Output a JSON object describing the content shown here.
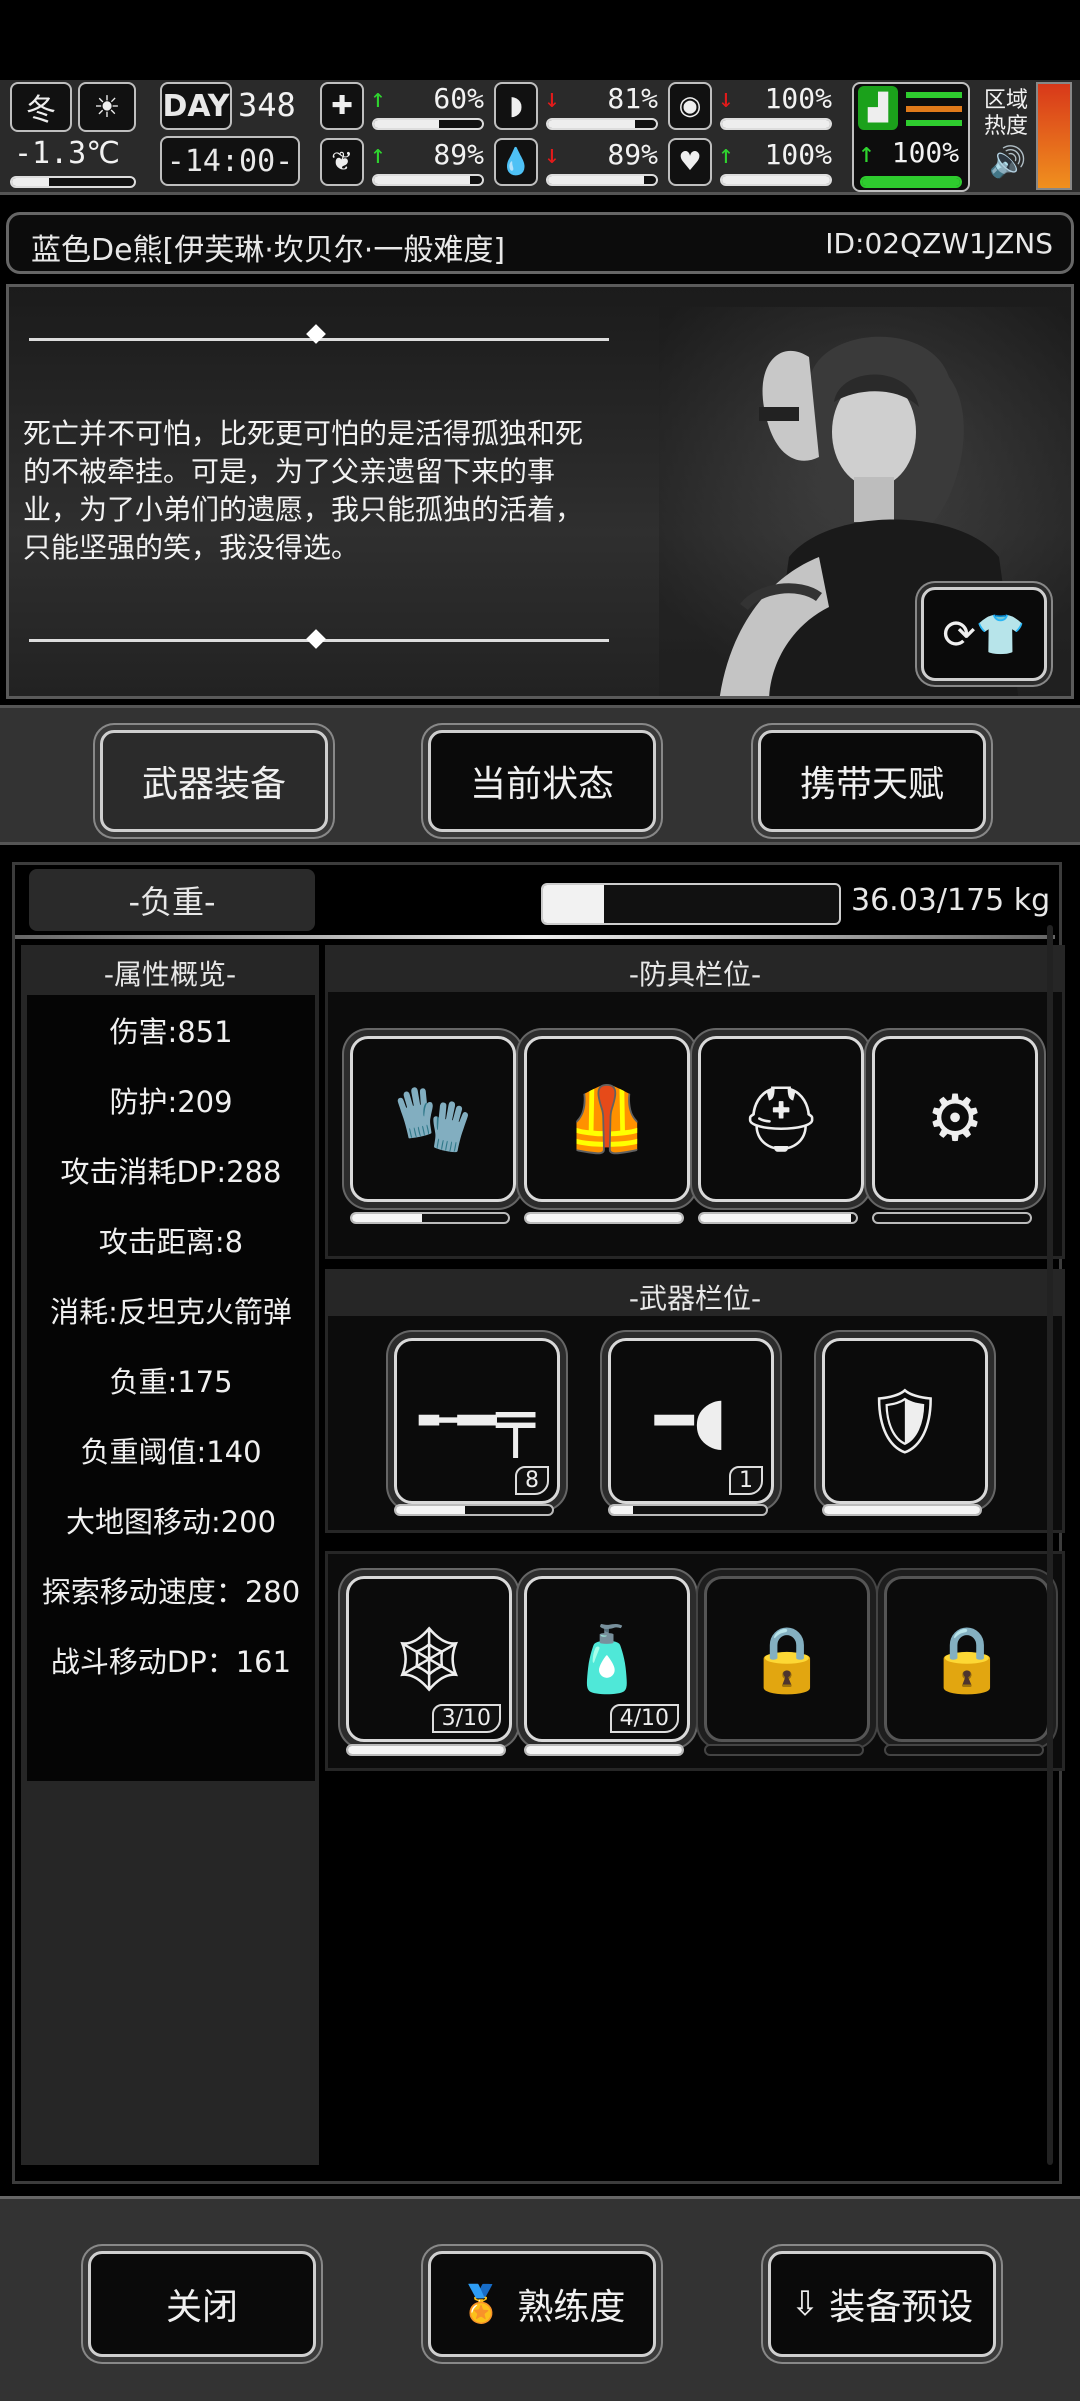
{
  "hud": {
    "season": "冬",
    "weather_icon": "sun-icon",
    "temperature": "-1.3℃",
    "day_label": "DAY",
    "day_value": "348",
    "time": "-14:00-",
    "stats": [
      {
        "name": "health",
        "icon": "medkit-icon",
        "trend": "up",
        "value": "60%",
        "fill": 0.6
      },
      {
        "name": "hunger",
        "icon": "stomach-icon",
        "trend": "down",
        "value": "81%",
        "fill": 0.81
      },
      {
        "name": "stamina",
        "icon": "lungs-icon",
        "trend": "down",
        "value": "100%",
        "fill": 1.0
      },
      {
        "name": "mood",
        "icon": "brain-icon",
        "trend": "up",
        "value": "89%",
        "fill": 0.89
      },
      {
        "name": "thirst",
        "icon": "water-drop-icon",
        "trend": "down",
        "value": "89%",
        "fill": 0.89
      },
      {
        "name": "heart",
        "icon": "heart-icon",
        "trend": "up",
        "value": "100%",
        "fill": 1.0
      }
    ],
    "foot_value": "100%",
    "foot_fill": 1.0,
    "region_heat_label": "区域热度"
  },
  "player": {
    "name_line": "蓝色De熊[伊芙琳·坎贝尔·一般难度]",
    "id_line": "ID:02QZW1JZNS"
  },
  "story": {
    "quote": "死亡并不可怕，比死更可怕的是活得孤独和死的不被牵挂。可是，为了父亲遗留下来的事业，为了小弟们的遗愿，我只能孤独的活着，只能坚强的笑，我没得选。"
  },
  "tabs": {
    "weapons": "武器装备",
    "status": "当前状态",
    "talents": "携带天赋"
  },
  "load": {
    "label": "-负重-",
    "value": "36.03/175 kg",
    "fraction": 0.206
  },
  "attributes": {
    "header": "-属性概览-",
    "items": [
      "伤害:851",
      "防护:209",
      "攻击消耗DP:288",
      "攻击距离:8",
      "消耗:反坦克火箭弹",
      "负重:175",
      "负重阈值:140",
      "大地图移动:200",
      "探索移动速度：280",
      "战斗移动DP：161"
    ]
  },
  "armor": {
    "header": "-防具栏位-",
    "slots": [
      {
        "name": "gloves-icon",
        "durability": 0.45
      },
      {
        "name": "body-armor-icon",
        "durability": 1.0
      },
      {
        "name": "helmet-icon",
        "durability": 0.97
      },
      {
        "name": "leg-armor-icon",
        "durability": 0
      }
    ]
  },
  "weapons": {
    "header": "-武器栏位-",
    "slots": [
      {
        "name": "sniper-rifle-icon",
        "count": "8",
        "durability": 0.44
      },
      {
        "name": "rocket-launcher-icon",
        "count": "1",
        "durability": 0.15
      },
      {
        "name": "riot-shield-icon",
        "count": "",
        "durability": 1.0
      }
    ]
  },
  "items": {
    "slots": [
      {
        "name": "net-icon",
        "count": "3/10",
        "durability": 1.0,
        "locked": false
      },
      {
        "name": "canister-icon",
        "count": "4/10",
        "durability": 1.0,
        "locked": false
      },
      {
        "name": "lock-icon",
        "count": "",
        "durability": 0,
        "locked": true
      },
      {
        "name": "lock-icon",
        "count": "",
        "durability": 0,
        "locked": true
      }
    ]
  },
  "bottom": {
    "close": "关闭",
    "proficiency": "熟练度",
    "preset": "装备预设"
  }
}
